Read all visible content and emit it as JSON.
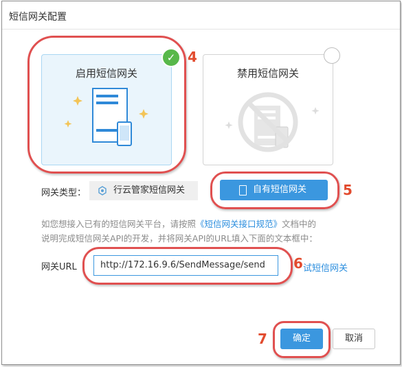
{
  "dialog": {
    "title": "短信网关配置"
  },
  "options": {
    "enable_label": "启用短信网关",
    "disable_label": "禁用短信网关"
  },
  "gateway_type": {
    "label": "网关类型：",
    "builtin_label": "行云管家短信网关",
    "own_label": "自有短信网关"
  },
  "description": {
    "line1_prefix": "如您想接入已有的短信网关平台，请按照",
    "line1_link": "《短信网关接口规范》",
    "line1_suffix": "文档中的",
    "line2": "说明完成短信网关API的开发，并将网关API的URL填入下面的文本框中："
  },
  "url_field": {
    "label": "网关URL",
    "value": "http://172.16.9.6/SendMessage/send",
    "test_link": "试短信网关"
  },
  "footer": {
    "ok_label": "确定",
    "cancel_label": "取消"
  },
  "annotations": {
    "n4": "4",
    "n5": "5",
    "n6": "6",
    "n7": "7"
  },
  "colors": {
    "accent": "#3b97df",
    "annotation": "#e05050",
    "check": "#58b84a"
  }
}
